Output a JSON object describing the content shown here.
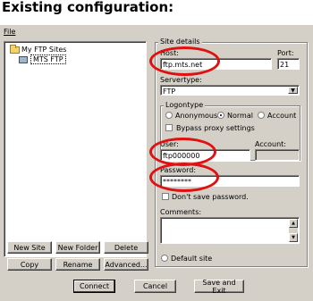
{
  "page": {
    "heading": "Existing configuration:"
  },
  "menubar": {
    "file": "File"
  },
  "tree": {
    "root": "My FTP Sites",
    "child": "MTS FTP"
  },
  "site_details": {
    "title": "Site details",
    "host_label": "Host:",
    "host_value": "ftp.mts.net",
    "port_label": "Port:",
    "port_value": "21",
    "servertype_label": "Servertype:",
    "servertype_value": "FTP",
    "logontype_title": "Logontype",
    "anonymous": "Anonymous",
    "normal": "Normal",
    "account": "Account",
    "bypass": "Bypass proxy settings",
    "user_label": "User:",
    "user_value": "ftp000000",
    "account_label": "Account:",
    "account_value": "",
    "password_label": "Password:",
    "password_value": "********",
    "dont_save": "Don't save password.",
    "comments_label": "Comments:",
    "default_site": "Default site"
  },
  "buttons": {
    "new_site": "New Site",
    "new_folder": "New Folder",
    "delete": "Delete",
    "copy": "Copy",
    "rename": "Rename",
    "advanced": "Advanced...",
    "connect": "Connect",
    "cancel": "Cancel",
    "save_exit": "Save and Exit"
  },
  "colors": {
    "highlight": "#e01010",
    "dialog": "#d4d0c8"
  }
}
